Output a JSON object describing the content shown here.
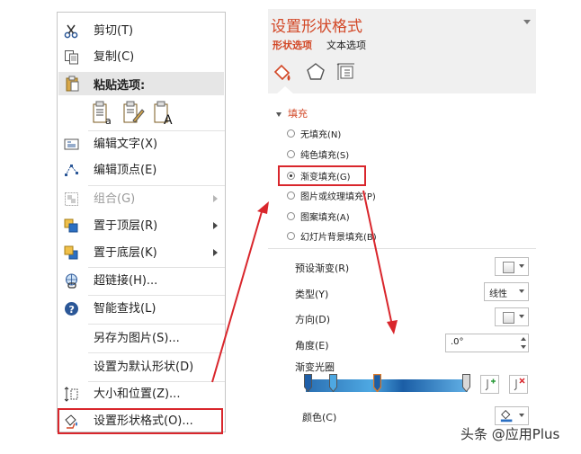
{
  "context_menu": {
    "items": [
      {
        "label": "剪切(T)",
        "icon": "scissors-icon"
      },
      {
        "label": "复制(C)",
        "icon": "copy-icon"
      },
      {
        "label": "编辑文字(X)",
        "icon": "edit-text-icon"
      },
      {
        "label": "编辑顶点(E)",
        "icon": "edit-points-icon"
      },
      {
        "label": "组合(G)",
        "icon": "group-icon"
      },
      {
        "label": "置于顶层(R)",
        "icon": "bring-to-front-icon"
      },
      {
        "label": "置于底层(K)",
        "icon": "send-to-back-icon"
      },
      {
        "label": "超链接(H)...",
        "icon": "hyperlink-icon"
      },
      {
        "label": "智能查找(L)",
        "icon": "smart-lookup-icon"
      },
      {
        "label": "另存为图片(S)..."
      },
      {
        "label": "设置为默认形状(D)"
      },
      {
        "label": "大小和位置(Z)...",
        "icon": "size-position-icon"
      },
      {
        "label": "设置形状格式(O)...",
        "icon": "format-shape-icon"
      }
    ],
    "paste_header": "粘贴选项:",
    "paste_icons": [
      "paste-theme-icon",
      "paste-picture-icon",
      "paste-text-only-icon"
    ]
  },
  "panel": {
    "title": "设置形状格式",
    "tabs": [
      "形状选项",
      "文本选项"
    ],
    "icons": [
      "fill-line-icon",
      "effects-icon",
      "size-properties-icon"
    ],
    "section": "填充",
    "fill_options": [
      {
        "label": "无填充(N)",
        "selected": false
      },
      {
        "label": "纯色填充(S)",
        "selected": false
      },
      {
        "label": "渐变填充(G)",
        "selected": true
      },
      {
        "label": "图片或纹理填充(P)",
        "selected": false
      },
      {
        "label": "图案填充(A)",
        "selected": false
      },
      {
        "label": "幻灯片背景填充(B)",
        "selected": false
      }
    ],
    "preset_label": "预设渐变(R)",
    "type_label": "类型(Y)",
    "type_value": "线性",
    "direction_label": "方向(D)",
    "angle_label": "角度(E)",
    "angle_value": ".0°",
    "stops_label": "渐变光圈",
    "color_label": "颜色(C)"
  },
  "watermark": "头条 @应用Plus",
  "colors": {
    "accent": "#d24726",
    "highlight": "#d9262c"
  }
}
